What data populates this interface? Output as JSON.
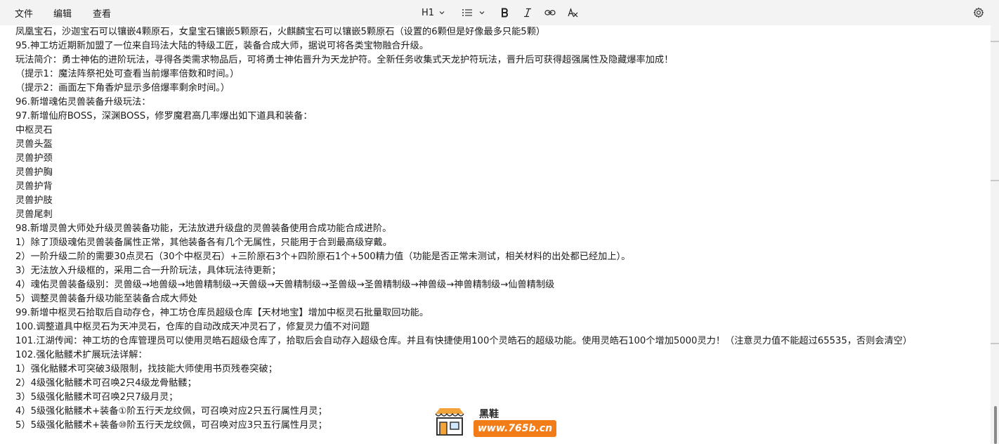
{
  "menu": {
    "file": "文件",
    "edit": "编辑",
    "view": "查看"
  },
  "format_toolbar": {
    "heading": "H1",
    "list_icon": "bullet-list-icon",
    "bold_icon": "bold-icon",
    "italic_icon": "italic-icon",
    "link_icon": "link-icon",
    "clear_format_icon": "clear-format-icon",
    "settings_icon": "gear-icon"
  },
  "document": {
    "lines": [
      "凤凰宝石，沙迦宝石可以镶嵌4颗原石，女皇宝石镶嵌5颗原石，火麒麟宝石可以镶嵌5颗原石（设置的6颗但是好像最多只能5颗）",
      "95.神工坊近期新加盟了一位来自玛法大陆的特级工匠，装备合成大师，据说可将各类宝物融合升级。",
      "玩法简介：勇士神佑的进阶玩法，寻得各类需求物品后，可将勇士神佑晋升为天龙护符。全新任务收集式天龙护符玩法，晋升后可获得超强属性及隐藏爆率加成！",
      "（提示1：魔法阵祭祀处可查看当前爆率倍数和时间。）",
      "（提示2：画面左下角香炉显示多倍爆率剩余时间。）",
      "96.新增魂佑灵兽装备升级玩法：",
      "97.新增仙府BOSS，深渊BOSS，修罗魔君高几率爆出如下道具和装备：",
      "中枢灵石",
      "灵兽头盔",
      "灵兽护颈",
      "灵兽护胸",
      "灵兽护背",
      "灵兽护肢",
      "灵兽尾刺",
      "98.新增灵兽大师处升级灵兽装备功能，无法放进升级盘的灵兽装备使用合成功能合成进阶。",
      "1）除了顶级魂佑灵兽装备属性正常，其他装备各有几个无属性，只能用于合到最高级穿戴。",
      "2）一阶升级二阶的需要30点灵石（30个中枢灵石）+三阶原石3个+四阶原石1个+500精力值（功能是否正常未测试，相关材料的出处都已经加上）。",
      "3）无法放入升级框的，采用二合一升阶玩法，具体玩法待更新；",
      "4）魂佑灵兽装备级别：灵兽级→地兽级→地兽精制级→天兽级→天兽精制级→圣兽级→圣兽精制级→神兽级→神兽精制级→仙兽精制级",
      "5）调整灵兽装备升级功能至装备合成大师处",
      "99.新增中枢灵石拾取后自动存仓，神工坊仓库员超级仓库【天材地宝】增加中枢灵石批量取回功能。",
      "100.调整道具中枢灵石为天冲灵石，仓库的自动改成天冲灵石了，修复灵力值不对问题",
      "101.江湖传闻：神工坊的仓库管理员可以使用灵皓石超级仓库了，拾取后会自动存入超级仓库。并且有快捷使用100个灵皓石的超级功能。使用灵皓石100个增加5000灵力！（注意灵力值不能超过65535，否则会清空）",
      "102.强化骷髅术扩展玩法详解：",
      "1）强化骷髅术可突破3级限制，找技能大师使用书页残卷突破；",
      "2）4级强化骷髅术可召唤2只4级龙骨骷髅；",
      "3）5级强化骷髅术可召唤2只7级月灵；",
      "4）5级强化骷髅术+装备①阶五行天龙纹佩，可召唤对应2只五行属性月灵；",
      "5）5级强化骷髅术+装备⑩阶五行天龙纹佩，可召唤对应3只五行属性月灵；"
    ]
  },
  "watermark": {
    "name": "黑鞋",
    "url": "www.765b.cn",
    "icon": "shop-icon"
  }
}
